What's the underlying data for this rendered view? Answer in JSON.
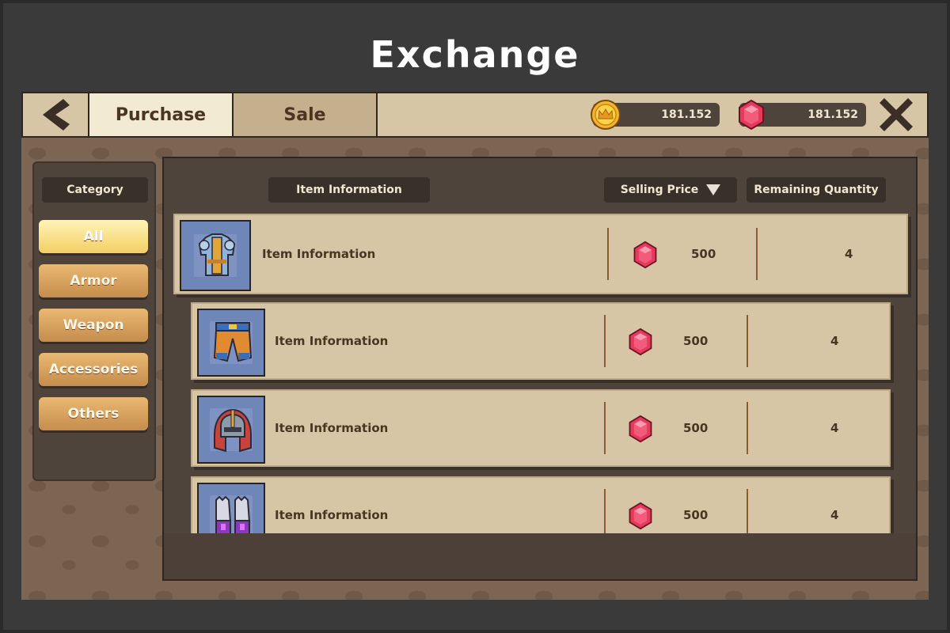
{
  "title": "Exchange",
  "topbar": {
    "back_icon": "chevron-left-icon",
    "tabs": [
      {
        "label": "Purchase",
        "active": true
      },
      {
        "label": "Sale",
        "active": false
      }
    ],
    "gold": {
      "icon": "crown-coin-icon",
      "value": "181.152"
    },
    "gems": {
      "icon": "red-gem-icon",
      "value": "181.152"
    },
    "close_icon": "close-icon"
  },
  "sidebar": {
    "header": "Category",
    "items": [
      {
        "label": "All",
        "active": true
      },
      {
        "label": "Armor",
        "active": false
      },
      {
        "label": "Weapon",
        "active": false
      },
      {
        "label": "Accessories",
        "active": false
      },
      {
        "label": "Others",
        "active": false
      }
    ]
  },
  "list": {
    "headers": {
      "info": "Item Information",
      "price": "Selling Price",
      "qty": "Remaining Quantity"
    },
    "sort_icon": "sort-down-icon",
    "rows": [
      {
        "icon": "armor-chest-icon",
        "name": "Item Information",
        "price": "500",
        "qty": "4"
      },
      {
        "icon": "pants-icon",
        "name": "Item Information",
        "price": "500",
        "qty": "4"
      },
      {
        "icon": "helmet-icon",
        "name": "Item Information",
        "price": "500",
        "qty": "4"
      },
      {
        "icon": "gauntlets-icon",
        "name": "Item Information",
        "price": "500",
        "qty": "4"
      }
    ]
  },
  "colors": {
    "background": "#3a3a3a",
    "panel": "#d7c6a6",
    "dark_panel": "#4f443b",
    "active_tab": "#f3ead3",
    "active_category": "#f3cf63",
    "gem": "#e63a5c",
    "gold": "#f4b52a"
  }
}
